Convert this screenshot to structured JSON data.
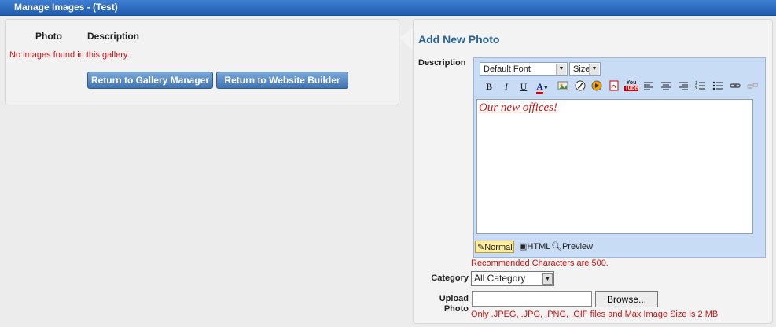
{
  "window": {
    "title": "Manage Images - (Test)"
  },
  "gallery": {
    "columns": [
      "Photo",
      "Description"
    ],
    "empty_message": "No images found in this gallery.",
    "buttons": {
      "gallery_manager": "Return to Gallery Manager",
      "website_builder": "Return to Website Builder"
    }
  },
  "add_photo": {
    "title": "Add New Photo",
    "description_label": "Description",
    "editor": {
      "font_select": "Default Font",
      "size_select": "Size",
      "toolbar_icons": [
        "bold-icon",
        "italic-icon",
        "underline-icon",
        "font-color-icon",
        "image-icon",
        "flash-icon",
        "media-icon",
        "pdf-icon",
        "youtube-icon",
        "align-left-icon",
        "align-center-icon",
        "align-right-icon",
        "ordered-list-icon",
        "unordered-list-icon",
        "link-icon",
        "unlink-icon"
      ],
      "content": "Our new offices!",
      "modes": {
        "normal": "Normal",
        "html": "HTML",
        "preview": "Preview"
      }
    },
    "recommended": "Recommended Characters are 500.",
    "category_label": "Category",
    "category_value": "All Category",
    "upload_label": "Upload Photo",
    "upload_input_value": "",
    "browse_label": "Browse...",
    "file_info": "Only .JPEG, .JPG, .PNG, .GIF files and Max Image Size is 2 MB"
  },
  "colors": {
    "accent": "#2a6496",
    "error": "#cc1111",
    "title_bar": "#2a66bb"
  }
}
